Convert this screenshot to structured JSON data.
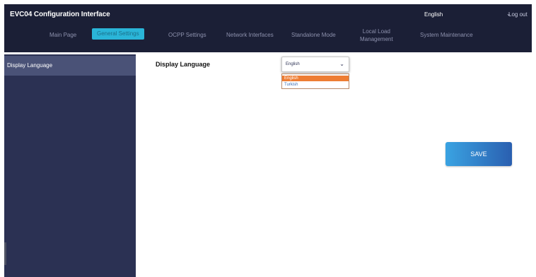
{
  "header": {
    "title": "EVC04 Configuration Interface",
    "language": "English",
    "logout_label": "Log out"
  },
  "nav": {
    "items": [
      {
        "label": "Main Page"
      },
      {
        "label": "General Settings"
      },
      {
        "label": "OCPP Settings"
      },
      {
        "label": "Network Interfaces"
      },
      {
        "label": "Standalone Mode"
      },
      {
        "label": "Local Load\nManagement"
      },
      {
        "label": "System Maintenance"
      }
    ],
    "active_index": 1
  },
  "sidebar": {
    "items": [
      {
        "label": "Display Language"
      }
    ]
  },
  "main": {
    "language_label": "Display Language",
    "language_select": {
      "value": "English",
      "options": [
        "English",
        "Turkish"
      ],
      "selected": "English"
    },
    "save_label": "SAVE"
  },
  "colors": {
    "topbar": "#1b1f36",
    "sidebar": "#2b3153",
    "active_tab": "#2ab5d8",
    "highlight_option": "#ee7d33",
    "save_button_start": "#3aa3e2",
    "save_button_end": "#2a5fb0"
  },
  "icons": {
    "language_dropdown": "chevron-down-icon",
    "select_dropdown": "chevron-down-icon"
  }
}
